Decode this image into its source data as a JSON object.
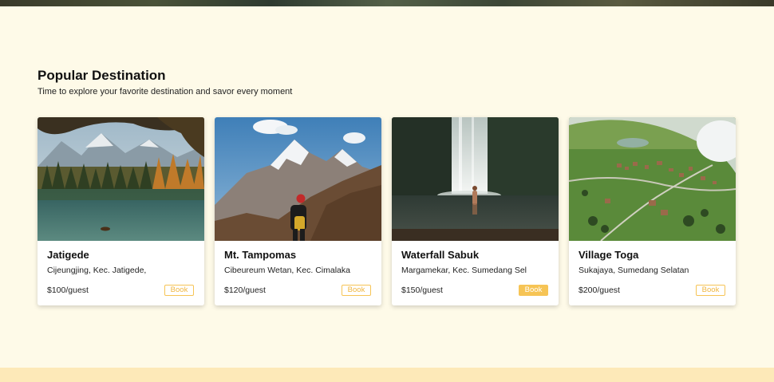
{
  "section": {
    "title": "Popular Destination",
    "subtitle": "Time to explore your favorite destination and savor every moment"
  },
  "cards": [
    {
      "name": "Jatigede",
      "location": "Cijeungjing, Kec. Jatigede,",
      "price": "$100/guest",
      "book_label": "Book",
      "book_active": false,
      "image": "lake-forest-mountains-photo"
    },
    {
      "name": "Mt. Tampomas",
      "location": "Cibeureum Wetan, Kec. Cimalaka",
      "price": "$120/guest",
      "book_label": "Book",
      "book_active": false,
      "image": "hiker-snowy-mountain-photo"
    },
    {
      "name": "Waterfall Sabuk",
      "location": "Margamekar, Kec. Sumedang Sel",
      "price": "$150/guest",
      "book_label": "Book",
      "book_active": true,
      "image": "waterfall-pool-photo"
    },
    {
      "name": "Village Toga",
      "location": "Sukajaya, Sumedang Selatan",
      "price": "$200/guest",
      "book_label": "Book",
      "book_active": false,
      "image": "aerial-village-photo"
    }
  ],
  "colors": {
    "background": "#fefae8",
    "accent": "#f6c455",
    "footer": "#fde9b8"
  }
}
